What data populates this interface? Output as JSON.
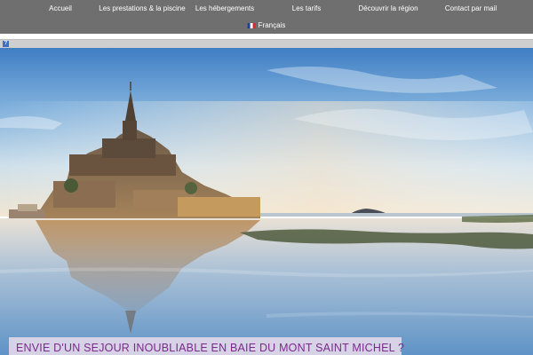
{
  "nav": {
    "items": [
      {
        "label": "Accueil"
      },
      {
        "label": "Les prestations & la piscine"
      },
      {
        "label": "Les hébergements"
      },
      {
        "label": "Les tarifs"
      },
      {
        "label": "Découvrir la région"
      },
      {
        "label": "Contact par mail"
      }
    ],
    "language": "Français",
    "flag_colors": [
      "#1f3f9a",
      "#ffffff",
      "#d7262e"
    ]
  },
  "help_icon": {
    "glyph": "?",
    "icon": "help-icon"
  },
  "hero": {
    "subject": "mont-saint-michel"
  },
  "banner": {
    "text": "ENVIE D'UN SEJOUR INOUBLIABLE EN BAIE DU MONT SAINT MICHEL ?"
  },
  "colors": {
    "nav_bg": "#6f6f6f",
    "banner_text": "#7a2a8c",
    "banner_bg": "#e1d7e8"
  }
}
